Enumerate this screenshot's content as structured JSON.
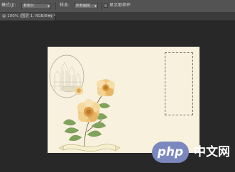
{
  "options_bar": {
    "size_label": "模式(J):",
    "size_value": "有限公",
    "layer_label": "样本:",
    "layer_value": "所有图层",
    "show_ring_label": "显示取样环"
  },
  "document_tab": {
    "title": "@ 100% (图层 1, RGB/8#) *",
    "close_glyph": "×"
  },
  "watermark": {
    "badge": "php",
    "text": "中文网"
  },
  "colors": {
    "app_bg": "#282828",
    "canvas_paper": "#f8f1de",
    "badge": "#7b87bf"
  }
}
